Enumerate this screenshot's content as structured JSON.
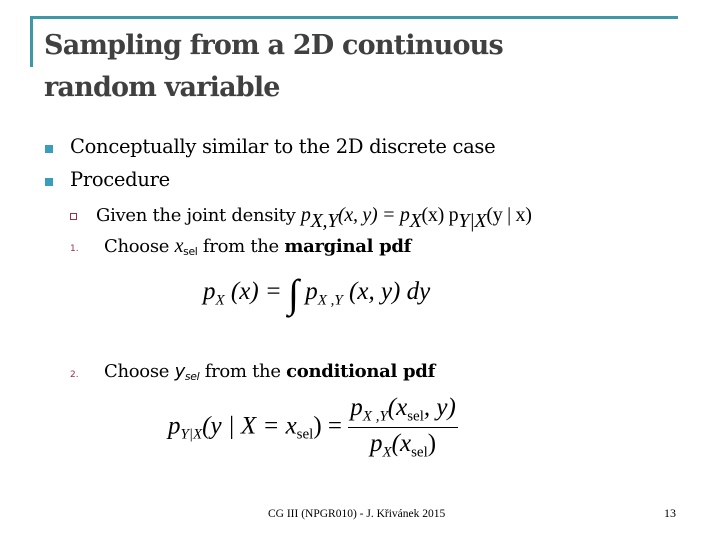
{
  "slide": {
    "title_line1": "Sampling from a 2D continuous",
    "title_line2": "random variable",
    "accent_color": "#3f98a8",
    "bullets": [
      {
        "text": "Conceptually similar to the 2D discrete case"
      },
      {
        "text": "Procedure"
      }
    ],
    "subitems": {
      "given": {
        "prefix": "Given the joint density ",
        "p": "p",
        "sub_xy": "X,Y",
        "args": "(x, y) = p",
        "sub_x": "X",
        "args2": "(x) p",
        "sub_yx": "Y|X",
        "args3": "(y | x)"
      },
      "step1": {
        "number": "1.",
        "text_a": "Choose ",
        "var": "x",
        "var_sub": "sel",
        "text_b": " from the ",
        "bold": "marginal pdf"
      },
      "step2": {
        "number": "2.",
        "text_a": "Choose ",
        "var": "y",
        "var_sub": "sel",
        "text_b": " from the ",
        "bold": "conditional pdf"
      }
    },
    "equation1": {
      "lhs_p": "p",
      "lhs_sub": "X",
      "lhs_args": "(x) = ",
      "integral": "∫",
      "rhs_p": "p",
      "rhs_sub": "X ,Y",
      "rhs_args": "(x, y) dy"
    },
    "equation2": {
      "lhs_p": "p",
      "lhs_sub": "Y|X",
      "lhs_args_a": "(y | X = x",
      "lhs_xsub": "sel",
      "lhs_args_b": ") = ",
      "num_p": "p",
      "num_sub": "X ,Y",
      "num_args_a": "(x",
      "num_xsub": "sel",
      "num_args_b": ", y)",
      "den_p": "p",
      "den_sub": "X",
      "den_args_a": "(x",
      "den_xsub": "sel",
      "den_args_b": ")"
    },
    "footer": "CG III (NPGR010) - J. Křivánek 2015",
    "page_number": "13"
  }
}
